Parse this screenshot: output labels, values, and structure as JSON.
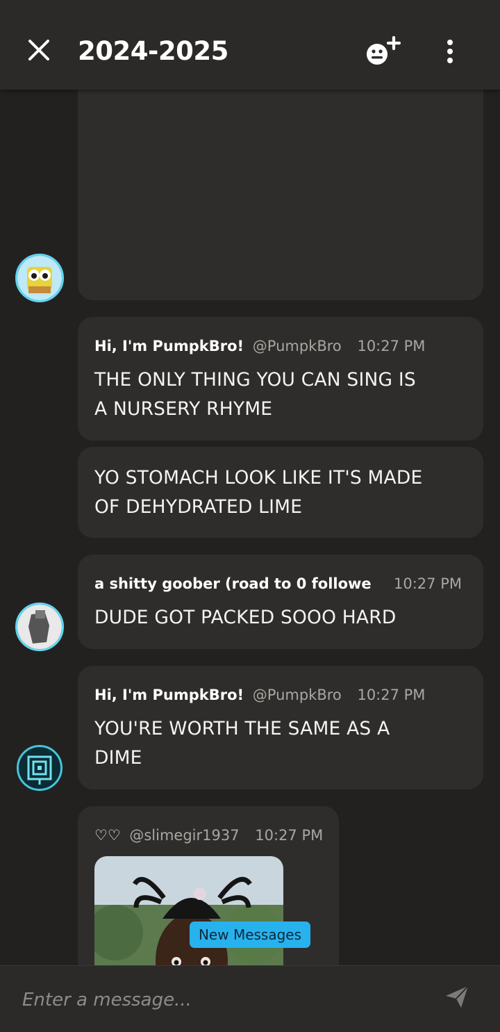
{
  "header": {
    "title": "2024-2025",
    "close_icon": "close-icon",
    "add_member_icon": "add-member-icon",
    "more_icon": "more-vertical-icon"
  },
  "messages": [
    {
      "author": "Hi, I'm PumpkBro!",
      "handle": "@PumpkBro",
      "time": "10:27 PM",
      "lines": [
        "THE ONLY THING YOU CAN SING IS",
        "A NURSERY RHYME"
      ]
    },
    {
      "lines": [
        "YO STOMACH LOOK LIKE IT'S MADE",
        "OF DEHYDRATED LIME"
      ]
    },
    {
      "author": "a shitty goober (road to 0 followe",
      "time": "10:27 PM",
      "lines": [
        "DUDE GOT PACKED SOOO HARD"
      ]
    },
    {
      "author": "Hi, I'm PumpkBro!",
      "handle": "@PumpkBro",
      "time": "10:27 PM",
      "lines": [
        "YOU'RE WORTH THE SAME AS A",
        "DIME"
      ]
    },
    {
      "author": "♡♡",
      "handle": "@slimegir1937",
      "time": "10:27 PM"
    }
  ],
  "new_messages_label": "New Messages",
  "composer": {
    "placeholder": "Enter a message...",
    "send_icon": "send-icon"
  },
  "colors": {
    "background": "#232120",
    "bar": "#2c2a28",
    "bubble": "#2f2d2b",
    "accent": "#27b2ee"
  }
}
